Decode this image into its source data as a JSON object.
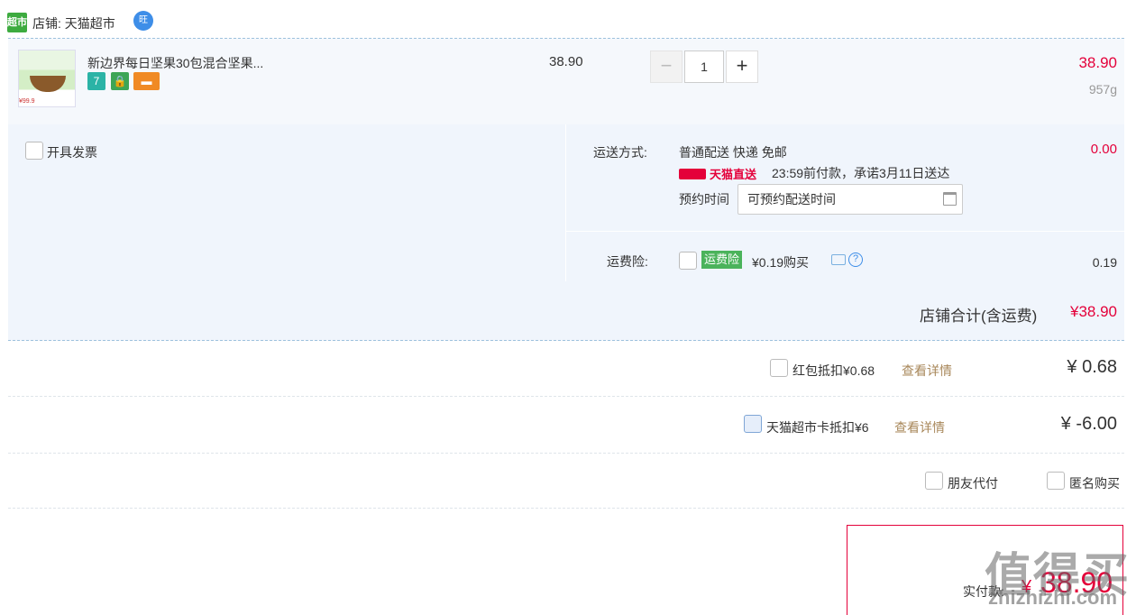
{
  "shop": {
    "logo_text": "超市",
    "label": "店铺: 天猫超市",
    "ww_text": "旺"
  },
  "item": {
    "title": "新边界每日坚果30包混合坚果...",
    "img_tag": "¥99.9",
    "unit_price": "38.90",
    "quantity": "1",
    "minus": "−",
    "plus": "+",
    "subtotal": "38.90",
    "weight": "957g",
    "badges": [
      "7",
      "🔒",
      "▬"
    ]
  },
  "invoice": {
    "label": "开具发票"
  },
  "delivery": {
    "label": "运送方式:",
    "method": "普通配送 快递 免邮",
    "fee": "0.00",
    "tmall_tag": "天猫直送",
    "promise": "23:59前付款，承诺3月11日送达",
    "reserve_label": "预约时间",
    "reserve_placeholder": "可预约配送时间"
  },
  "insurance": {
    "label": "运费险:",
    "tag": "运费险",
    "price_text": "¥0.19购买",
    "amount": "0.19",
    "help": "?"
  },
  "shop_total": {
    "label": "店铺合计(含运费)",
    "amount": "¥38.90"
  },
  "redpacket": {
    "label": "红包抵扣¥0.68",
    "detail": "查看详情",
    "amount": "¥ 0.68"
  },
  "tmallcard": {
    "label": "天猫超市卡抵扣¥6",
    "detail": "查看详情",
    "amount": "¥ -6.00"
  },
  "options": {
    "friend_pay": "朋友代付",
    "anonymous": "匿名购买"
  },
  "final": {
    "label": "实付款:",
    "currency": "¥",
    "amount": "38.90"
  },
  "watermark": {
    "main": "值得买",
    "sub": "zhizhizhi.com"
  }
}
